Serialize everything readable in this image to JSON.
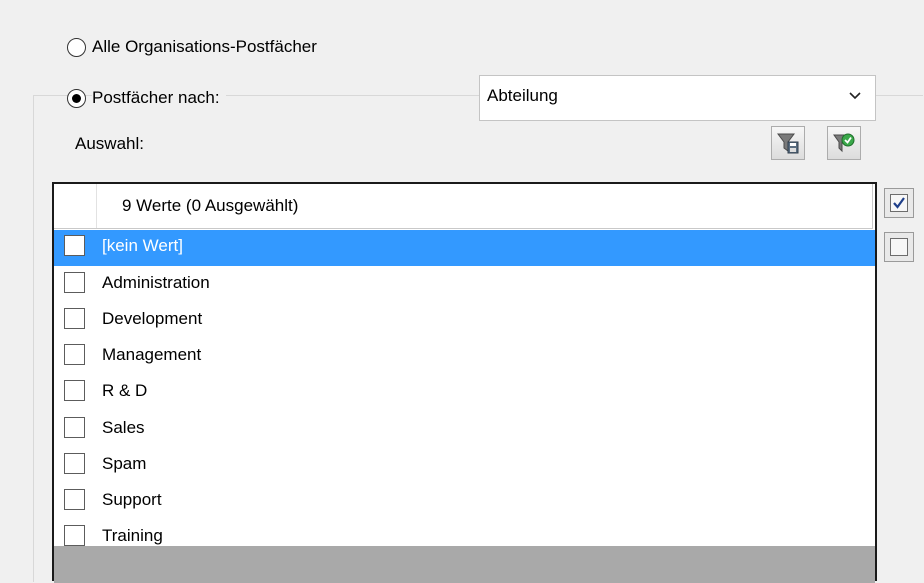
{
  "options": {
    "all_mailboxes_label": "Alle Organisations-Postfächer",
    "by_property_label": "Postfächer nach:",
    "selected_option": "by_property"
  },
  "combo": {
    "value": "Abteilung"
  },
  "selection_label": "Auswahl:",
  "toolbar": {
    "filter_save_icon": "filter-save-icon",
    "filter_apply_icon": "filter-apply-icon"
  },
  "grid": {
    "header": "9 Werte (0 Ausgewählt)",
    "rows": [
      {
        "label": "[kein Wert]",
        "checked": false,
        "selected": true
      },
      {
        "label": "Administration",
        "checked": false,
        "selected": false
      },
      {
        "label": "Development",
        "checked": false,
        "selected": false
      },
      {
        "label": "Management",
        "checked": false,
        "selected": false
      },
      {
        "label": "R & D",
        "checked": false,
        "selected": false
      },
      {
        "label": "Sales",
        "checked": false,
        "selected": false
      },
      {
        "label": "Spam",
        "checked": false,
        "selected": false
      },
      {
        "label": "Support",
        "checked": false,
        "selected": false
      },
      {
        "label": "Training",
        "checked": false,
        "selected": false
      }
    ]
  },
  "side_buttons": {
    "select_all_icon": "check-all-icon",
    "select_none_icon": "uncheck-all-icon"
  },
  "colors": {
    "selection": "#3399ff",
    "footer": "#a9a9a9"
  }
}
